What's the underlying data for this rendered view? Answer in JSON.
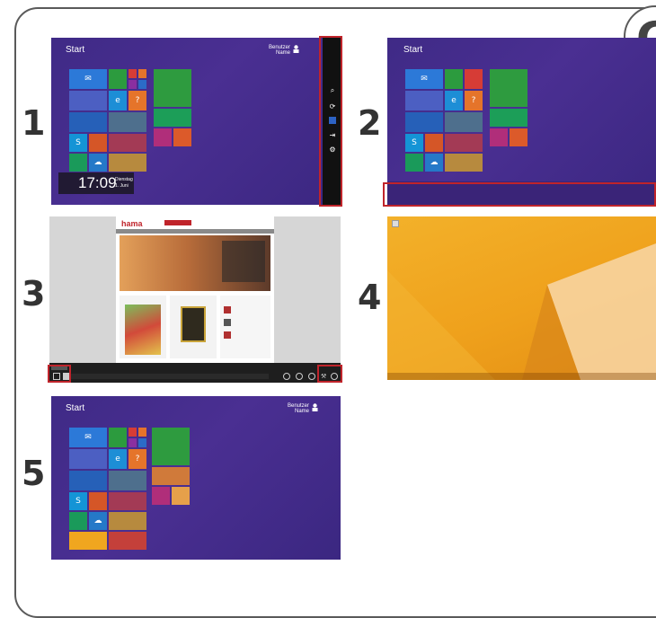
{
  "badge_letter": "C",
  "steps": [
    "1",
    "2",
    "3",
    "4",
    "5"
  ],
  "start_screen": {
    "title": "Start",
    "user_first": "Benutzer",
    "user_last": "Name"
  },
  "clock": {
    "time": "17:09",
    "weekday": "Dienstag",
    "date": "1. Juni"
  },
  "browser": {
    "logo": "hama"
  },
  "colors": {
    "highlight": "#c0242b",
    "start_bg": "#432c8a",
    "desktop_bg": "#f0a61f"
  }
}
